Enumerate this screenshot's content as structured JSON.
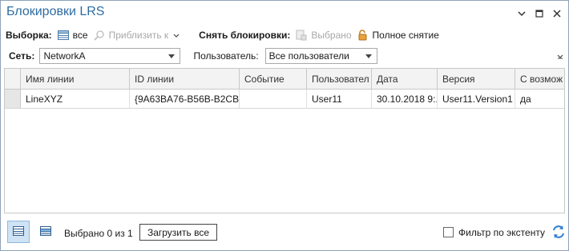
{
  "window": {
    "title": "Блокировки LRS",
    "controls": [
      "chevron-down-icon",
      "restore-icon",
      "close-icon"
    ]
  },
  "toolbar": {
    "selection_label": "Выборка:",
    "all_label": "все",
    "zoom_label": "Приблизить к",
    "unlock_label": "Снять блокировки:",
    "selected_label": "Выбрано",
    "full_release_label": "Полное снятие"
  },
  "filters": {
    "network_label": "Сеть:",
    "network_value": "NetworkA",
    "user_label": "Пользователь:",
    "user_value": "Все пользователи"
  },
  "table": {
    "columns": [
      "Имя линии",
      "ID линии",
      "Событие",
      "Пользовател",
      "Дата",
      "Версия",
      "С возмож"
    ],
    "rows": [
      [
        "LineXYZ",
        "{9A63BA76-B56B-B2CB-...",
        "",
        "User11",
        "30.10.2018 9:...",
        "User11.Version1",
        "да"
      ]
    ]
  },
  "footer": {
    "status": "Выбрано 0 из 1",
    "load_all": "Загрузить все",
    "extent_filter": "Фильтр по экстенту",
    "extent_checked": false
  },
  "colors": {
    "title": "#2d6ca2",
    "accent": "#2b7cd3",
    "disabled": "#a8a8a8"
  }
}
